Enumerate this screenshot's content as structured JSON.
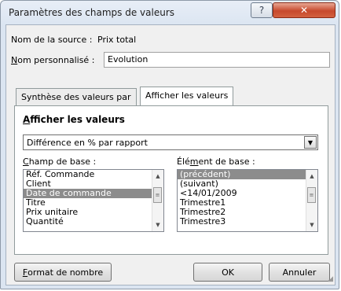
{
  "window": {
    "title": "Paramètres des champs de valeurs",
    "help_label": "?",
    "close_label": "✕"
  },
  "source": {
    "label": "Nom de la source :",
    "value": "Prix total"
  },
  "custom_name": {
    "label_first": "N",
    "label_rest": "om personnalisé :",
    "value": "Evolution"
  },
  "tabs": [
    {
      "label": "Synthèse des valeurs par"
    },
    {
      "label": "Afficher les valeurs"
    }
  ],
  "section": {
    "title_first": "A",
    "title_rest": "fficher les valeurs"
  },
  "show_as": {
    "selected": "Différence en % par rapport",
    "arrow": "▼"
  },
  "base_field": {
    "label_first": "C",
    "label_rest": "hamp de base :",
    "items": [
      "Réf. Commande",
      "Client",
      "Date de commande",
      "Titre",
      "Prix unitaire",
      "Quantité"
    ],
    "selected_index": 2
  },
  "base_item": {
    "label_first": "Élé",
    "label_u": "m",
    "label_rest": "ent de base :",
    "items": [
      "(précédent)",
      "(suivant)",
      "<14/01/2009",
      "Trimestre1",
      "Trimestre2",
      "Trimestre3"
    ],
    "selected_index": 0
  },
  "scroll": {
    "up": "▲",
    "down": "▼",
    "thumb": "≡"
  },
  "buttons": {
    "format_first": "F",
    "format_rest": "ormat de nombre",
    "ok": "OK",
    "cancel": "Annuler"
  }
}
